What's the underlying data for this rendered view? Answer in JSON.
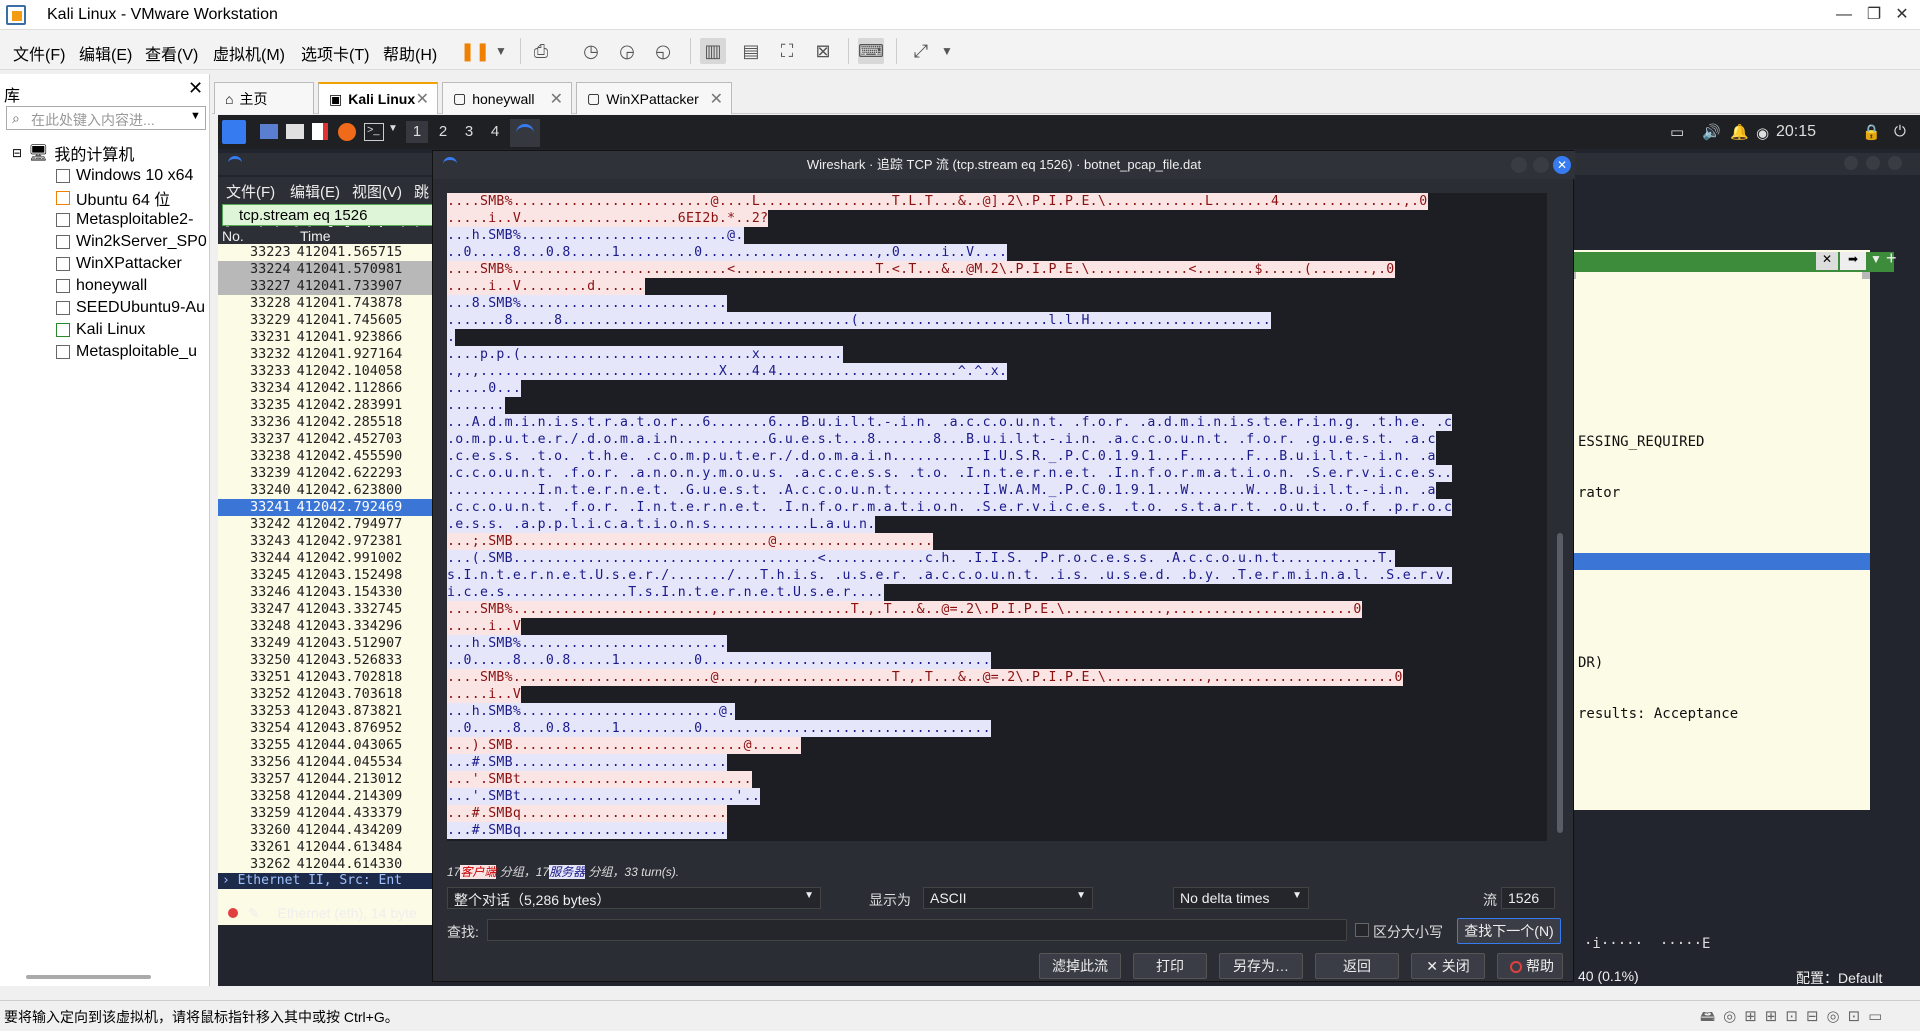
{
  "window": {
    "title": "Kali Linux - VMware Workstation"
  },
  "menu": [
    "文件(F)",
    "编辑(E)",
    "查看(V)",
    "虚拟机(M)",
    "选项卡(T)",
    "帮助(H)"
  ],
  "library": {
    "title": "库",
    "search_placeholder": "在此处键入内容进...",
    "root": "我的计算机",
    "vms": [
      "Windows 10 x64",
      "Ubuntu 64 位",
      "Metasploitable2-",
      "Win2kServer_SP0",
      "WinXPattacker",
      "honeywall",
      "SEEDUbuntu9-Au",
      "Kali Linux",
      "Metasploitable_u"
    ]
  },
  "tabs": [
    {
      "label": "主页"
    },
    {
      "label": "Kali Linux",
      "active": true
    },
    {
      "label": "honeywall"
    },
    {
      "label": "WinXPattacker"
    }
  ],
  "kali_panel": {
    "workspaces": [
      "1",
      "2",
      "3",
      "4"
    ],
    "clock": "20:15"
  },
  "wireshark": {
    "menu": [
      "文件(F)",
      "编辑(E)",
      "视图(V)",
      "跳"
    ],
    "filter": "tcp.stream eq 1526",
    "columns": {
      "no": "No.",
      "time": "Time"
    },
    "packets": [
      [
        "33223",
        "412041.565715"
      ],
      [
        "33224",
        "412041.570981"
      ],
      [
        "33227",
        "412041.733907"
      ],
      [
        "33228",
        "412041.743878"
      ],
      [
        "33229",
        "412041.745605"
      ],
      [
        "33231",
        "412041.923866"
      ],
      [
        "33232",
        "412041.927164"
      ],
      [
        "33233",
        "412042.104058"
      ],
      [
        "33234",
        "412042.112866"
      ],
      [
        "33235",
        "412042.283991"
      ],
      [
        "33236",
        "412042.285518"
      ],
      [
        "33237",
        "412042.452703"
      ],
      [
        "33238",
        "412042.455590"
      ],
      [
        "33239",
        "412042.622293"
      ],
      [
        "33240",
        "412042.623800"
      ],
      [
        "33241",
        "412042.792469"
      ],
      [
        "33242",
        "412042.794977"
      ],
      [
        "33243",
        "412042.972381"
      ],
      [
        "33244",
        "412042.991002"
      ],
      [
        "33245",
        "412043.152498"
      ],
      [
        "33246",
        "412043.154330"
      ],
      [
        "33247",
        "412043.332745"
      ],
      [
        "33248",
        "412043.334296"
      ],
      [
        "33249",
        "412043.512907"
      ],
      [
        "33250",
        "412043.526833"
      ],
      [
        "33251",
        "412043.702818"
      ],
      [
        "33252",
        "412043.703618"
      ],
      [
        "33253",
        "412043.873821"
      ],
      [
        "33254",
        "412043.876952"
      ],
      [
        "33255",
        "412044.043065"
      ],
      [
        "33256",
        "412044.045534"
      ],
      [
        "33257",
        "412044.213012"
      ],
      [
        "33258",
        "412044.214309"
      ],
      [
        "33259",
        "412044.433379"
      ],
      [
        "33260",
        "412044.434209"
      ],
      [
        "33261",
        "412044.613484"
      ],
      [
        "33262",
        "412044.614330"
      ]
    ],
    "detail_row": "› Ethernet II, Src: Ent",
    "status_left": "Ethernet (eth), 14 byte",
    "right_detail": [
      "ESSING_REQUIRED",
      "rator",
      "",
      "",
      "",
      "",
      "DR)",
      "results: Acceptance"
    ],
    "right_hex": "·i·····  ·····E",
    "right_status": "40 (0.1%)",
    "profile": "配置：Default"
  },
  "dialog": {
    "title": "Wireshark · 追踪 TCP 流 (tcp.stream eq 1526) · botnet_pcap_file.dat",
    "lines": [
      [
        "c",
        "....SMB%........................@....L................T.L.T...&..@].2\\.P.I.P.E.\\............L.......4...............,.0"
      ],
      [
        "c",
        ".....i..V...................6EI2b.*..2?"
      ],
      [
        "s",
        "...h.SMB%.........................@."
      ],
      [
        "s",
        "..0.....8...0.8.....1.........0.....................,.0.....i..V...."
      ],
      [
        "c",
        "....SMB%..........................<.................T.<.T...&..@M.2\\.P.I.P.E.\\............<.......$.....(.......,.0"
      ],
      [
        "c",
        ".....i..V........d......"
      ],
      [
        "s",
        "...8.SMB%........................."
      ],
      [
        "s",
        ".......8.....8...................................(.......................l.l.H......................"
      ],
      [
        "s",
        "."
      ],
      [
        "s",
        "....p.p.(............................x.........."
      ],
      [
        "s",
        ".,.,.............................X...4.4......................^.^.x."
      ],
      [
        "s",
        ".....0..."
      ],
      [
        "s",
        "......."
      ],
      [
        "s",
        "...A.d.m.i.n.i.s.t.r.a.t.o.r...6.......6...B.u.i.l.t.-.i.n. .a.c.c.o.u.n.t. .f.o.r. .a.d.m.i.n.i.s.t.e.r.i.n.g. .t.h.e. .c"
      ],
      [
        "s",
        ".o.m.p.u.t.e.r./.d.o.m.a.i.n...........G.u.e.s.t...8.......8...B.u.i.l.t.-.i.n. .a.c.c.o.u.n.t. .f.o.r. .g.u.e.s.t. .a.c"
      ],
      [
        "s",
        ".c.e.s.s. .t.o. .t.h.e. .c.o.m.p.u.t.e.r./.d.o.m.a.i.n...........I.U.S.R._.P.C.0.1.9.1...F.......F...B.u.i.l.t.-.i.n. .a"
      ],
      [
        "s",
        ".c.c.o.u.n.t. .f.o.r. .a.n.o.n.y.m.o.u.s. .a.c.c.e.s.s. .t.o. .I.n.t.e.r.n.e.t. .I.n.f.o.r.m.a.t.i.o.n. .S.e.r.v.i.c.e.s.."
      ],
      [
        "s",
        "...........I.n.t.e.r.n.e.t. .G.u.e.s.t. .A.c.c.o.u.n.t...........I.W.A.M._.P.C.0.1.9.1...W.......W...B.u.i.l.t.-.i.n. .a"
      ],
      [
        "s",
        ".c.c.o.u.n.t. .f.o.r. .I.n.t.e.r.n.e.t. .I.n.f.o.r.m.a.t.i.o.n. .S.e.r.v.i.c.e.s. .t.o. .s.t.a.r.t. .o.u.t. .o.f. .p.r.o.c"
      ],
      [
        "s",
        ".e.s.s. .a.p.p.l.i.c.a.t.i.o.n.s............L.a.u.n."
      ],
      [
        "c",
        "...;.SMB...............................@..................."
      ],
      [
        "s",
        "...(.SMB.....................................<............c.h. .I.I.S. .P.r.o.c.e.s.s. .A.c.c.o.u.n.t............T."
      ],
      [
        "s",
        "s.I.n.t.e.r.n.e.t.U.s.e.r./......./...T.h.i.s. .u.s.e.r. .a.c.c.o.u.n.t. .i.s. .u.s.e.d. .b.y. .T.e.r.m.i.n.a.l. .S.e.r.v."
      ],
      [
        "s",
        "i.c.e.s...............T.s.I.n.t.e.r.n.e.t.U.s.e.r...."
      ],
      [
        "c",
        "....SMB%........................,................T.,.T...&..@=.2\\.P.I.P.E.\\............,......................0"
      ],
      [
        "c",
        ".....i..V"
      ],
      [
        "s",
        "...h.SMB%........................."
      ],
      [
        "s",
        "..0.....8...0.8.....1.........0..................................."
      ],
      [
        "c",
        "....SMB%........................@....,................T.,.T...&..@=.2\\.P.I.P.E.\\............,......................0"
      ],
      [
        "c",
        ".....i..V"
      ],
      [
        "s",
        "...h.SMB%........................@."
      ],
      [
        "s",
        "..0.....8...0.8.....1.........0..................................."
      ],
      [
        "c",
        "...).SMB............................@......"
      ],
      [
        "s",
        "...#.SMB.........................."
      ],
      [
        "c",
        "...'.SMBt............................"
      ],
      [
        "s",
        "...'.SMBt..........................'.."
      ],
      [
        "c",
        "...#.SMBq........................."
      ],
      [
        "s",
        "...#.SMBq........................."
      ]
    ],
    "summary_client_count": "17",
    "summary_client": "客户端",
    "summary_sep1": " 分组，",
    "summary_server_count": "17",
    "summary_server": "服务器",
    "summary_sep2": " 分组，33 turn(s).",
    "conversation": "整个对话（5,286 bytes）",
    "show_as_label": "显示为",
    "show_as": "ASCII",
    "delta": "No delta times",
    "stream_label": "流",
    "stream_value": "1526",
    "find_label": "查找:",
    "case_label": "区分大小写",
    "find_next": "查找下一个(N)",
    "buttons": [
      "滤掉此流",
      "打印",
      "另存为…",
      "返回",
      "✕ 关闭",
      "帮助"
    ]
  },
  "statusbar": {
    "text": "要将输入定向到该虚拟机，请将鼠标指针移入其中或按 Ctrl+G。"
  }
}
